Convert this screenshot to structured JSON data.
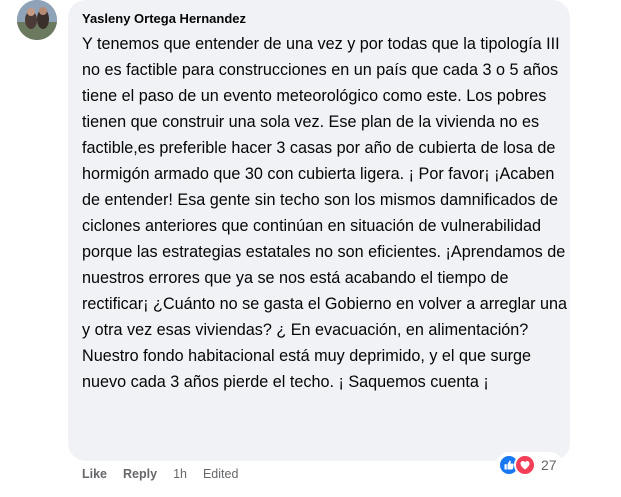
{
  "comment": {
    "author": "Yasleny Ortega Hernandez",
    "text": "Y tenemos que entender de una vez y por todas que la tipología III no es factible para construcciones en un país que cada 3 o 5 años tiene el paso de un evento meteorológico como este. Los pobres tienen que construir una sola vez. Ese plan de la vivienda no es factible,es preferible hacer 3 casas por año de cubierta de losa de hormigón armado que 30 con cubierta ligera. ¡ Por favor¡ ¡Acaben de entender! Esa gente sin techo son los mismos damnificados de ciclones anteriores que continúan en situación de vulnerabilidad porque las estrategias estatales no son eficientes. ¡Aprendamos de nuestros errores que ya se nos está acabando el tiempo de rectificar¡ ¿Cuánto no se gasta el Gobierno en volver a arreglar una y otra vez esas viviendas? ¿ En evacuación, en alimentación? Nuestro fondo habitacional está muy deprimido, y el que surge nuevo cada 3 años pierde el techo. ¡ Saquemos cuenta ¡"
  },
  "actions": {
    "like_label": "Like",
    "reply_label": "Reply",
    "time": "1h",
    "edited": "Edited"
  },
  "reactions": {
    "icons": [
      "like-icon",
      "love-icon"
    ],
    "count": "27",
    "like_color": "#1877f2",
    "love_color": "#f33e58"
  }
}
